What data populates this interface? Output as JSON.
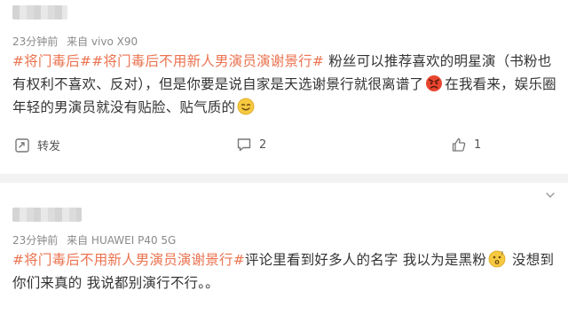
{
  "posts": [
    {
      "meta": {
        "time": "23分钟前",
        "source": "来自 vivo X90"
      },
      "content": {
        "hashtag1": "#将门毒后#",
        "hashtag2": "#将门毒后不用新人男演员演谢景行#",
        "text1": " 粉丝可以推荐喜欢的明星演（书粉也有权利不喜欢、反对），但是你要是说自家是天选谢景行就很离谱了",
        "text2": "在我看来，娱乐圈年轻的男演员就没有贴脸、贴气质的"
      },
      "emojis": [
        "angry-face-emoji",
        "smile-face-emoji"
      ],
      "actions": {
        "repost_label": "转发",
        "comment_count": "2",
        "like_count": "1"
      }
    },
    {
      "meta": {
        "time": "23分钟前",
        "source": "来自 HUAWEI P40 5G"
      },
      "content": {
        "hashtag1": "#将门毒后不用新人男演员演谢景行#",
        "text1": "评论里看到好多人的名字 我以为是黑粉",
        "text2": " 没想到你们来真的 我说都别演行不行。。"
      },
      "emojis": [
        "thinking-face-emoji"
      ]
    }
  ],
  "colors": {
    "hashtag": "#eb7350",
    "meta": "#8a8a8a",
    "separator": "#f2f2f2"
  }
}
